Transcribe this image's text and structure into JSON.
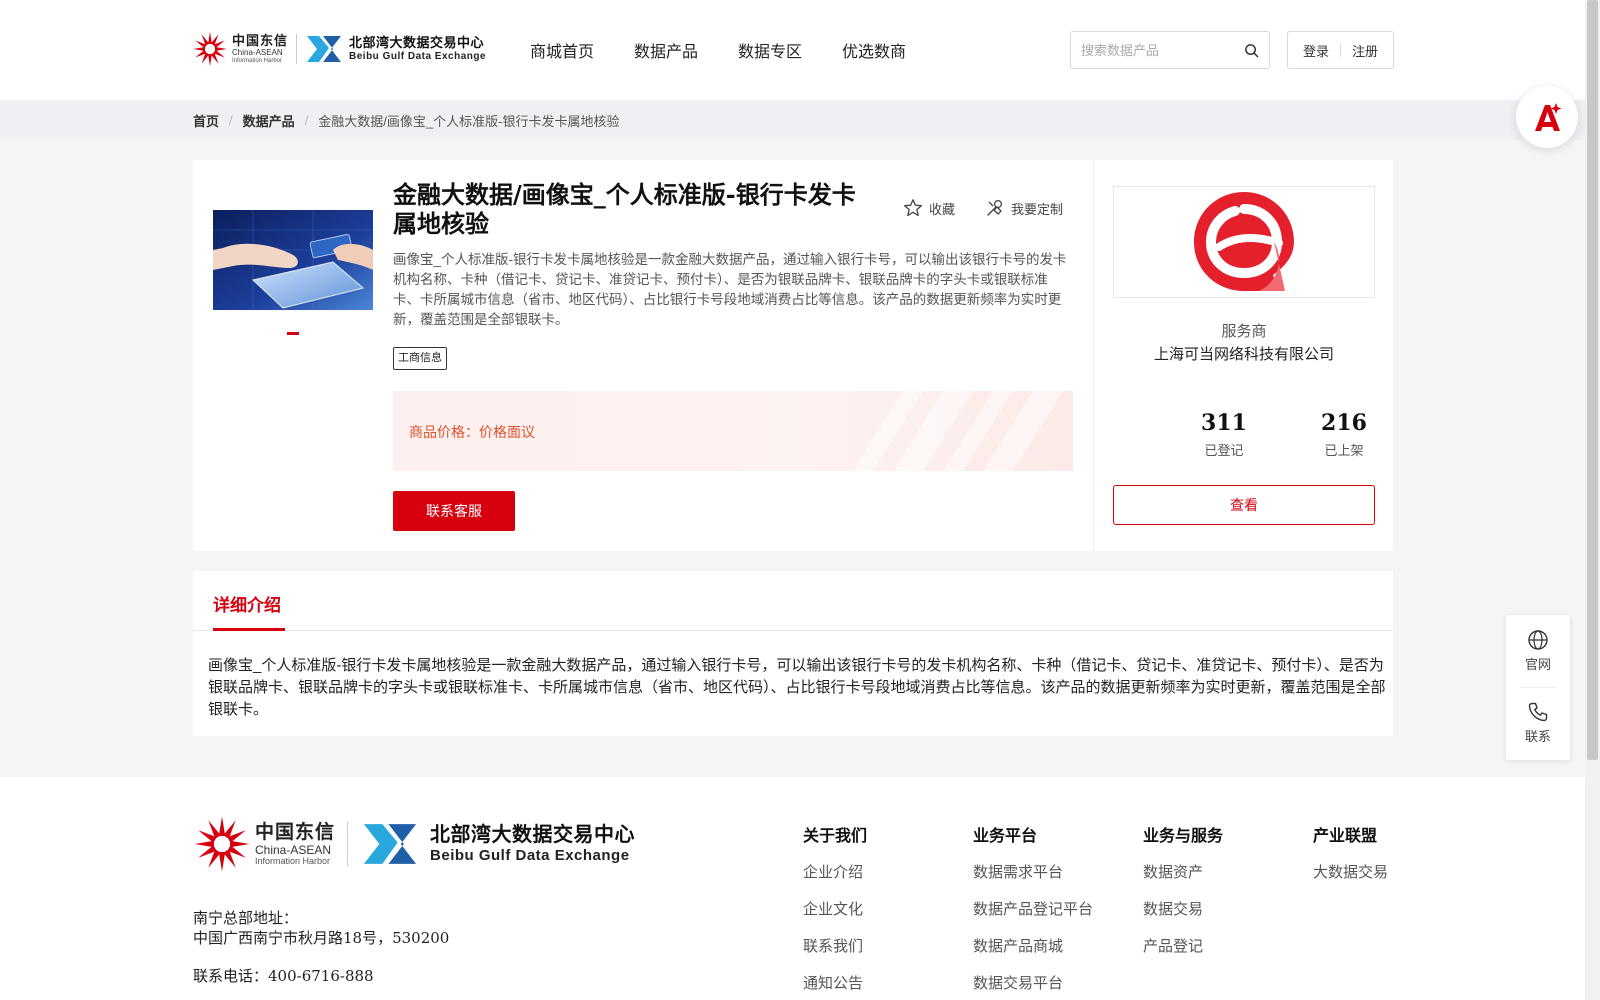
{
  "header": {
    "brand_ct_cn": "中国东信",
    "brand_ct_en1": "China-ASEAN",
    "brand_ct_en2": "Information Harbor",
    "brand_bb_cn": "北部湾大数据交易中心",
    "brand_bb_en": "Beibu Gulf Data Exchange",
    "nav": [
      "商城首页",
      "数据产品",
      "数据专区",
      "优选数商"
    ],
    "search_placeholder": "搜索数据产品",
    "login": "登录",
    "register": "注册"
  },
  "breadcrumb": {
    "home": "首页",
    "category": "数据产品",
    "current": "金融大数据/画像宝_个人标准版-银行卡发卡属地核验"
  },
  "product": {
    "title": "金融大数据/画像宝_个人标准版-银行卡发卡属地核验",
    "favorite": "收藏",
    "customize": "我要定制",
    "description": "画像宝_个人标准版-银行卡发卡属地核验是一款金融大数据产品，通过输入银行卡号，可以输出该银行卡号的发卡机构名称、卡种（借记卡、贷记卡、准贷记卡、预付卡）、是否为银联品牌卡、银联品牌卡的字头卡或银联标准卡、卡所属城市信息（省市、地区代码）、占比银行卡号段地域消费占比等信息。该产品的数据更新频率为实时更新，覆盖范围是全部银联卡。",
    "tag": "工商信息",
    "price_label": "商品价格：",
    "price_value": "价格面议",
    "contact_button": "联系客服"
  },
  "provider": {
    "role": "服务商",
    "name": "上海可当网络科技有限公司",
    "registered_count": "311",
    "registered_label": "已登记",
    "listed_count": "216",
    "listed_label": "已上架",
    "view_button": "查看"
  },
  "detail": {
    "tab": "详细介绍",
    "text": "画像宝_个人标准版-银行卡发卡属地核验是一款金融大数据产品，通过输入银行卡号，可以输出该银行卡号的发卡机构名称、卡种（借记卡、贷记卡、准贷记卡、预付卡）、是否为银联品牌卡、银联品牌卡的字头卡或银联标准卡、卡所属城市信息（省市、地区代码）、占比银行卡号段地域消费占比等信息。该产品的数据更新频率为实时更新，覆盖范围是全部银联卡。"
  },
  "float": {
    "official": "官网",
    "contact": "联系"
  },
  "footer": {
    "address_label": "南宁总部地址：",
    "address": "中国广西南宁市秋月路18号，530200",
    "phone": "联系电话：400-6716-888",
    "columns": [
      {
        "title": "关于我们",
        "items": [
          "企业介绍",
          "企业文化",
          "联系我们",
          "通知公告"
        ]
      },
      {
        "title": "业务平台",
        "items": [
          "数据需求平台",
          "数据产品登记平台",
          "数据产品商城",
          "数据交易平台"
        ]
      },
      {
        "title": "业务与服务",
        "items": [
          "数据资产",
          "数据交易",
          "产品登记"
        ]
      },
      {
        "title": "产业联盟",
        "items": [
          "大数据交易"
        ]
      }
    ]
  },
  "colors": {
    "accent": "#d7000f",
    "price": "#e0522e",
    "page_bg": "#f4f5f7"
  }
}
